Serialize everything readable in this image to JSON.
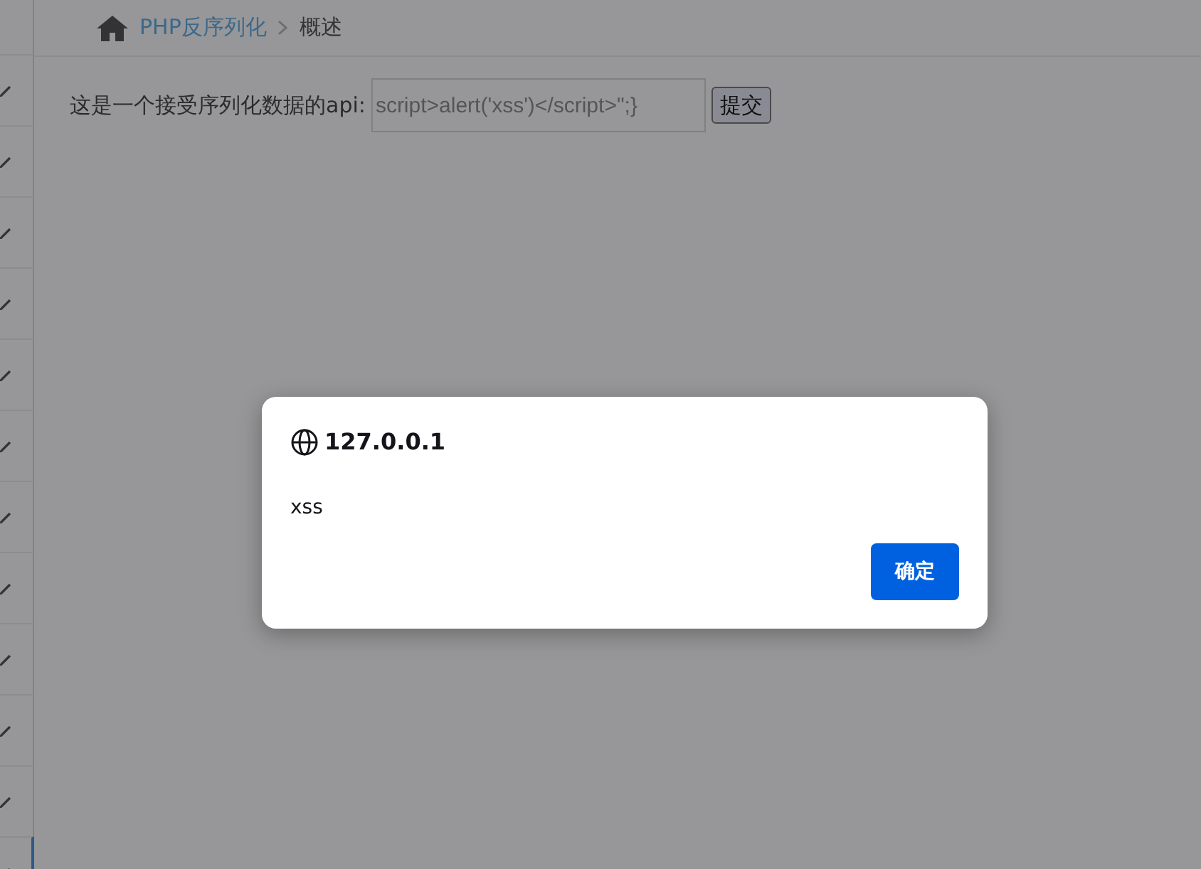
{
  "breadcrumb": {
    "items": [
      {
        "label": "PHP反序列化",
        "kind": "link"
      },
      {
        "label": "概述",
        "kind": "current"
      }
    ]
  },
  "sidebar": {
    "items": [
      {
        "selected": false
      },
      {
        "selected": false
      },
      {
        "selected": false
      },
      {
        "selected": false
      },
      {
        "selected": false
      },
      {
        "selected": false
      },
      {
        "selected": false
      },
      {
        "selected": false
      },
      {
        "selected": false
      },
      {
        "selected": false
      },
      {
        "selected": false
      },
      {
        "selected": true
      }
    ]
  },
  "form": {
    "label": "这是一个接受序列化数据的api:",
    "value": "script>alert('xss')</script>\";}",
    "button": "提交"
  },
  "dialog": {
    "title": "127.0.0.1",
    "message": "xss",
    "button": "确定"
  }
}
